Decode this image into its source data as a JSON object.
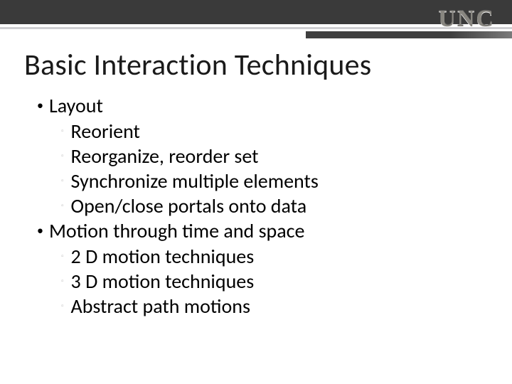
{
  "header": {
    "logo": "UNC"
  },
  "title": "Basic Interaction Techniques",
  "bullets": [
    {
      "text": "Layout",
      "children": [
        {
          "text": "Reorient"
        },
        {
          "text": "Reorganize, reorder set"
        },
        {
          "text": "Synchronize multiple elements"
        },
        {
          "text": "Open/close portals onto data"
        }
      ]
    },
    {
      "text": "Motion through time and space",
      "children": [
        {
          "text": "2 D motion techniques"
        },
        {
          "text": "3 D motion techniques"
        },
        {
          "text": "Abstract path motions"
        }
      ]
    }
  ]
}
